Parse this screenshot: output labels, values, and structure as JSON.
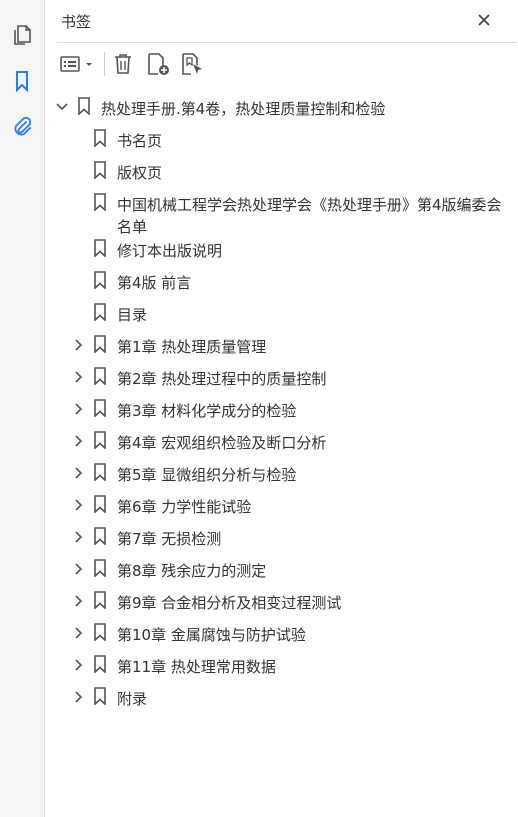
{
  "panel": {
    "title": "书签"
  },
  "rail": {
    "icons": [
      "copy-pages-icon",
      "bookmark-icon",
      "attachment-icon"
    ]
  },
  "toolbar": {
    "icons": [
      "options-menu-icon",
      "delete-icon",
      "new-bookmark-icon",
      "bookmark-from-selection-icon"
    ]
  },
  "tree": {
    "root": {
      "label": "热处理手册.第4卷，热处理质量控制和检验",
      "expanded": true
    },
    "items": [
      {
        "label": "书名页",
        "expandable": false
      },
      {
        "label": "版权页",
        "expandable": false
      },
      {
        "label": "中国机械工程学会热处理学会《热处理手册》第4版编委会　名单",
        "expandable": false
      },
      {
        "label": "修订本出版说明",
        "expandable": false
      },
      {
        "label": "第4版 前言",
        "expandable": false
      },
      {
        "label": "目录",
        "expandable": false
      },
      {
        "label": "第1章 热处理质量管理",
        "expandable": true
      },
      {
        "label": "第2章 热处理过程中的质量控制",
        "expandable": true
      },
      {
        "label": "第3章 材料化学成分的检验",
        "expandable": true
      },
      {
        "label": "第4章 宏观组织检验及断口分析",
        "expandable": true
      },
      {
        "label": "第5章 显微组织分析与检验",
        "expandable": true
      },
      {
        "label": "第6章 力学性能试验",
        "expandable": true
      },
      {
        "label": "第7章 无损检测",
        "expandable": true
      },
      {
        "label": "第8章 残余应力的测定",
        "expandable": true
      },
      {
        "label": "第9章 合金相分析及相变过程测试",
        "expandable": true
      },
      {
        "label": "第10章 金属腐蚀与防护试验",
        "expandable": true
      },
      {
        "label": "第11章 热处理常用数据",
        "expandable": true
      },
      {
        "label": "附录",
        "expandable": true
      }
    ]
  },
  "colors": {
    "accent": "#2b7de9",
    "icon": "#555555",
    "text": "#333333"
  }
}
